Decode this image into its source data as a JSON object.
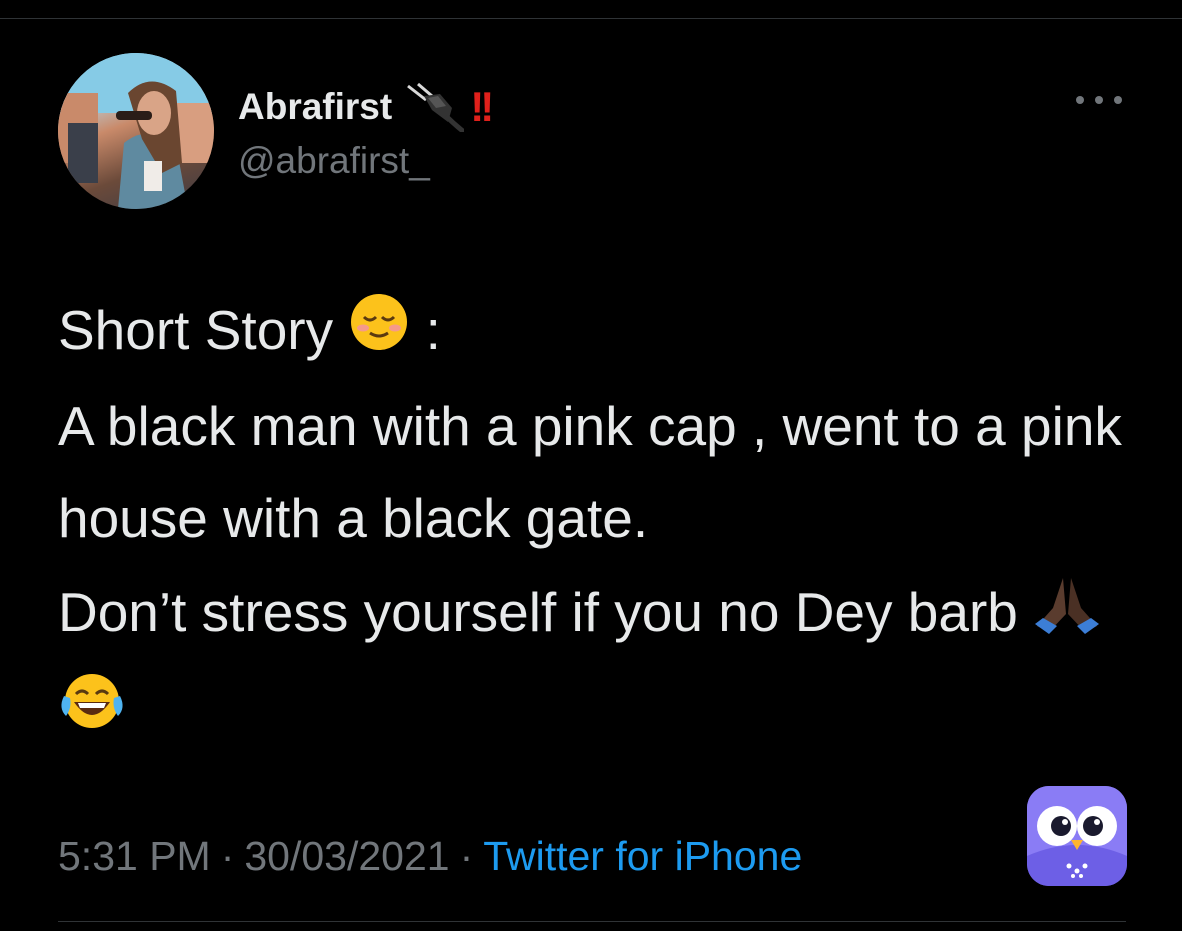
{
  "tweet": {
    "author": {
      "display_name": "Abrafirst",
      "name_icons": [
        "electric-plug-icon",
        "double-exclamation-icon"
      ],
      "handle": "@abrafirst_"
    },
    "more_icon": "more-options-icon",
    "text_lines": [
      "Short Story",
      ":",
      "A black man with a pink cap , went to a pink house with a black gate.",
      "Don’t stress yourself if you no Dey barb"
    ],
    "emojis": [
      "relieved-face",
      "folded-hands-dark-skin",
      "face-with-tears-of-joy"
    ],
    "time": "5:31 PM",
    "date": "30/03/2021",
    "separator": "·",
    "source": "Twitter for iPhone"
  },
  "colors": {
    "background": "#000000",
    "text": "#e7e9ea",
    "secondary": "#71767b",
    "link": "#1d9bf0",
    "alert": "#e0201b",
    "badge": "#7d6ff0"
  }
}
